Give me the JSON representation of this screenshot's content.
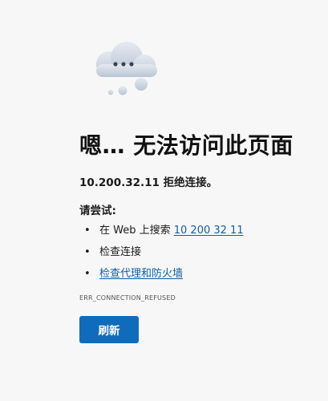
{
  "error_page": {
    "title": "嗯… 无法访问此页面",
    "reason": "10.200.32.11 拒绝连接。",
    "try_heading": "请尝试:",
    "suggestions": [
      {
        "prefix": "在 Web 上搜索 ",
        "link": "10 200 32 11"
      },
      {
        "text": "检查连接"
      },
      {
        "link": "检查代理和防火墙"
      }
    ],
    "error_code": "ERR_CONNECTION_REFUSED",
    "refresh_label": "刷新"
  },
  "colors": {
    "background": "#f7f7f7",
    "link": "#0f5fa8",
    "button": "#0f6cbd",
    "cloud": "#c9d3df"
  },
  "icons": {
    "hero": "sad-cloud-icon"
  }
}
